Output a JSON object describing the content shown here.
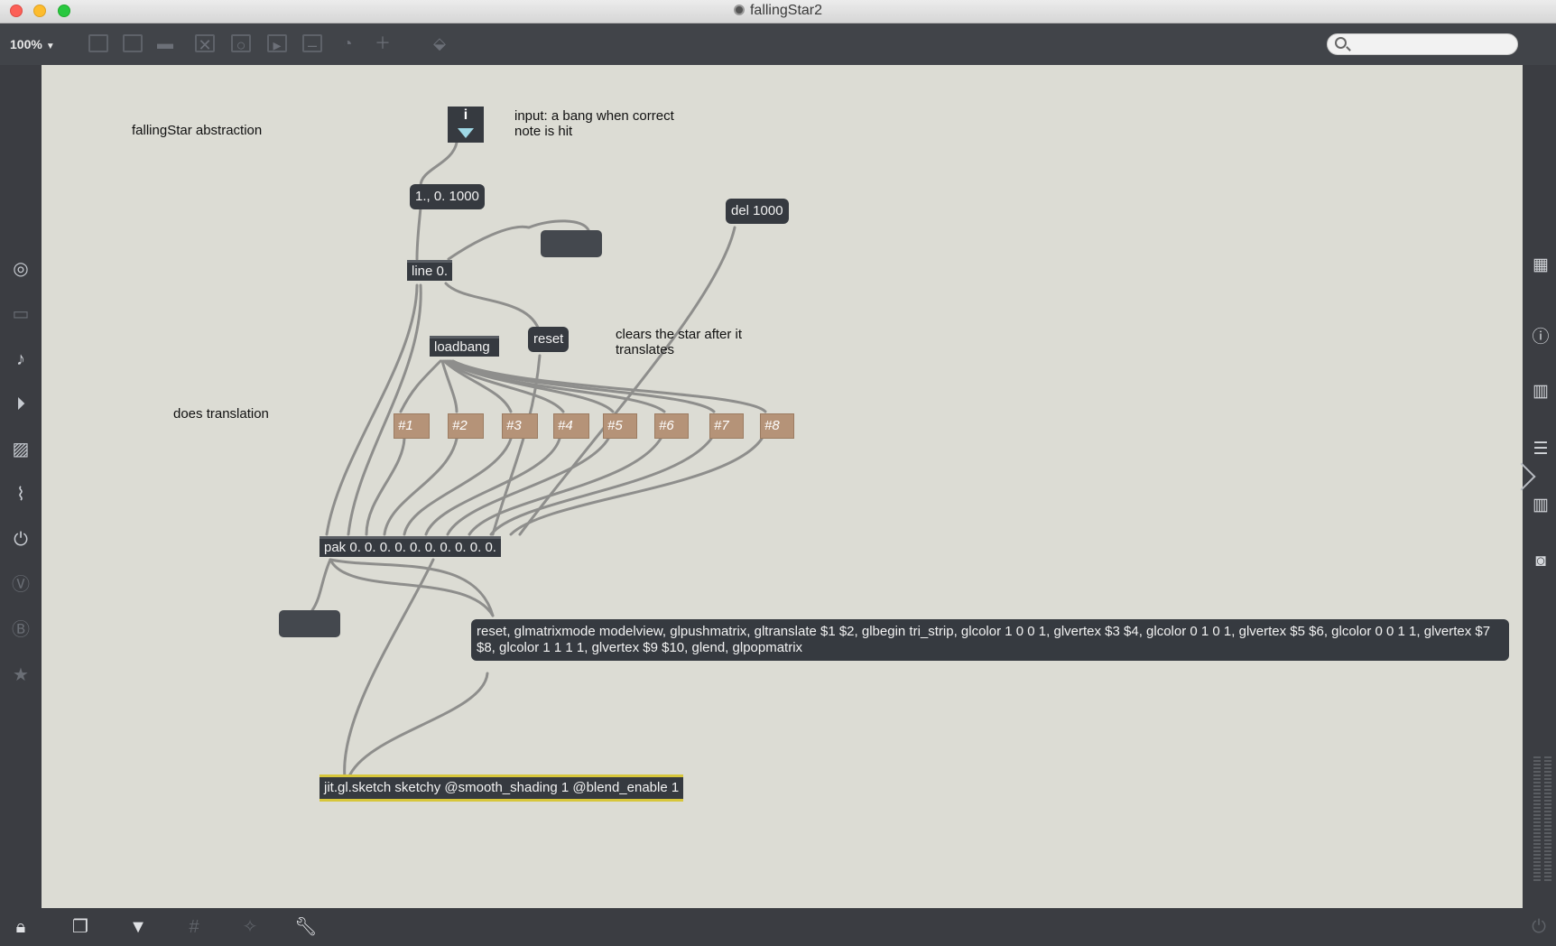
{
  "window": {
    "title": "fallingStar2"
  },
  "toolbar": {
    "zoom": "100%",
    "search_placeholder": ""
  },
  "patch": {
    "comments": {
      "abstraction": "fallingStar abstraction",
      "input_note": "input: a bang when correct\nnote is hit",
      "clears_note": "clears the star after it\ntranslates",
      "translation_note": "does translation"
    },
    "inlet_label": "i",
    "messages": {
      "line_msg": "1., 0. 1000",
      "reset": "reset",
      "gl_commands": "reset, glmatrixmode modelview, glpushmatrix, gltranslate $1 $2, glbegin tri_strip, glcolor 1 0 0 1, glvertex $3 $4, glcolor 0 1 0 1, glvertex $5 $6, glcolor 0 0 1 1, glvertex $7 $8, glcolor 1 1 1 1, glvertex $9 $10, glend, glpopmatrix"
    },
    "objects": {
      "del": "del 1000",
      "line": "line 0.",
      "loadbang": "loadbang",
      "pak": "pak 0. 0. 0. 0. 0. 0. 0. 0. 0. 0.",
      "jit_sketch": "jit.gl.sketch sketchy @smooth_shading 1 @blend_enable 1"
    },
    "presets": [
      "#1",
      "#2",
      "#3",
      "#4",
      "#5",
      "#6",
      "#7",
      "#8"
    ]
  }
}
